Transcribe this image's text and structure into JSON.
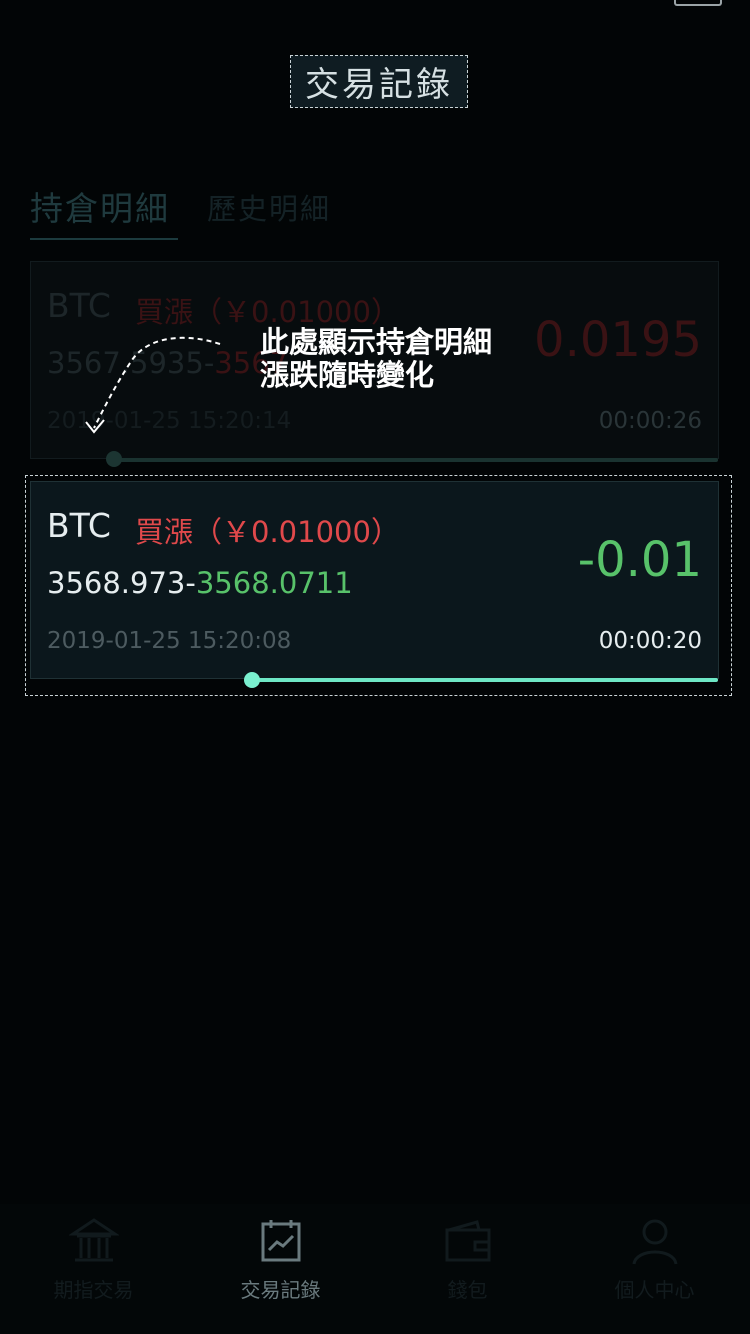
{
  "page_title": "交易記錄",
  "tabs": [
    {
      "label": "持倉明細",
      "active": true
    },
    {
      "label": "歷史明細",
      "active": false
    }
  ],
  "positions": [
    {
      "symbol": "BTC",
      "direction": "買漲",
      "stake": "（￥0.01000）",
      "open_price": "3567.5935-",
      "current_price": "3567",
      "pnl": "0.0195",
      "opened_at": "2019-01-25 15:20:14",
      "countdown": "00:00:26",
      "progress": 0.12
    },
    {
      "symbol": "BTC",
      "direction": "買漲",
      "stake": "（￥0.01000）",
      "open_price": "3568.973-",
      "current_price": "3568.0711",
      "pnl": "-0.01",
      "opened_at": "2019-01-25 15:20:08",
      "countdown": "00:00:20",
      "progress": 0.32
    }
  ],
  "annotation": {
    "line1": "此處顯示持倉明細",
    "line2": "漲跌隨時變化"
  },
  "tabbar": [
    {
      "label": "期指交易",
      "icon": "bank-icon"
    },
    {
      "label": "交易記錄",
      "icon": "chart-icon"
    },
    {
      "label": "錢包",
      "icon": "wallet-icon"
    },
    {
      "label": "個人中心",
      "icon": "user-icon"
    }
  ],
  "colors": {
    "background": "#020506",
    "rise": "#e0494b",
    "fall": "#58c26a",
    "accent": "#6ee7c5"
  }
}
